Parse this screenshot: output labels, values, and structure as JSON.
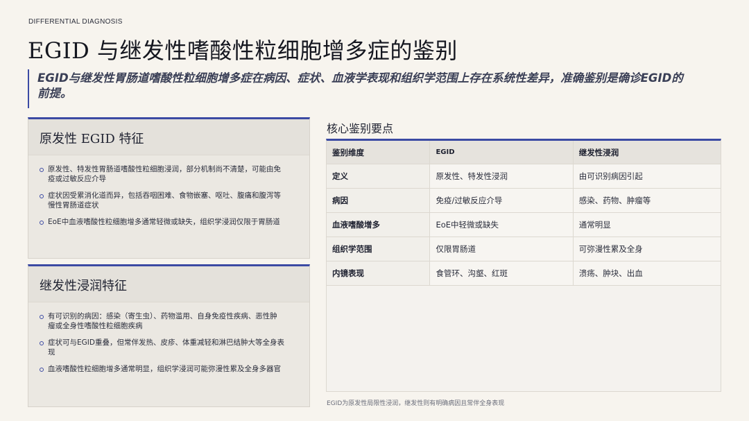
{
  "kicker": "DIFFERENTIAL DIAGNOSIS",
  "title": "EGID 与继发性嗜酸性粒细胞增多症的鉴别",
  "lead": "EGID与继发性胃肠道嗜酸性粒细胞增多症在病因、症状、血液学表现和组织学范围上存在系统性差异，准确鉴别是确诊EGID的前提。",
  "primary": {
    "heading": "原发性 EGID 特征",
    "items": [
      "原发性、特发性胃肠道嗜酸性粒细胞浸润，部分机制尚不清楚，可能由免疫或过敏反应介导",
      "症状因受累消化道而异，包括吞咽困难、食物嵌塞、呕吐、腹痛和腹泻等慢性胃肠道症状",
      "EoE中血液嗜酸性粒细胞增多通常轻微或缺失，组织学浸润仅限于胃肠道"
    ]
  },
  "secondary": {
    "heading": "继发性浸润特征",
    "items": [
      "有可识别的病因：感染（寄生虫）、药物滥用、自身免疫性疾病、恶性肿瘤或全身性嗜酸性粒细胞疾病",
      "症状可与EGID重叠，但常伴发热、皮疹、体重减轻和淋巴结肿大等全身表现",
      "血液嗜酸性粒细胞增多通常明显，组织学浸润可能弥漫性累及全身多器官"
    ]
  },
  "table": {
    "section_title": "核心鉴别要点",
    "headers": [
      "鉴别维度",
      "EGID",
      "继发性浸润"
    ],
    "rows": [
      [
        "定义",
        "原发性、特发性浸润",
        "由可识别病因引起"
      ],
      [
        "病因",
        "免疫/过敏反应介导",
        "感染、药物、肿瘤等"
      ],
      [
        "血液嗜酸增多",
        "EoE中轻微或缺失",
        "通常明显"
      ],
      [
        "组织学范围",
        "仅限胃肠道",
        "可弥漫性累及全身"
      ],
      [
        "内镜表现",
        "食管环、沟壑、红斑",
        "溃疡、肿块、出血"
      ]
    ]
  },
  "footnote": "EGID为原发性局限性浸润，继发性则有明确病因且常伴全身表现",
  "colors": {
    "accent": "#3b4aa3",
    "background": "#f7f4ee"
  }
}
